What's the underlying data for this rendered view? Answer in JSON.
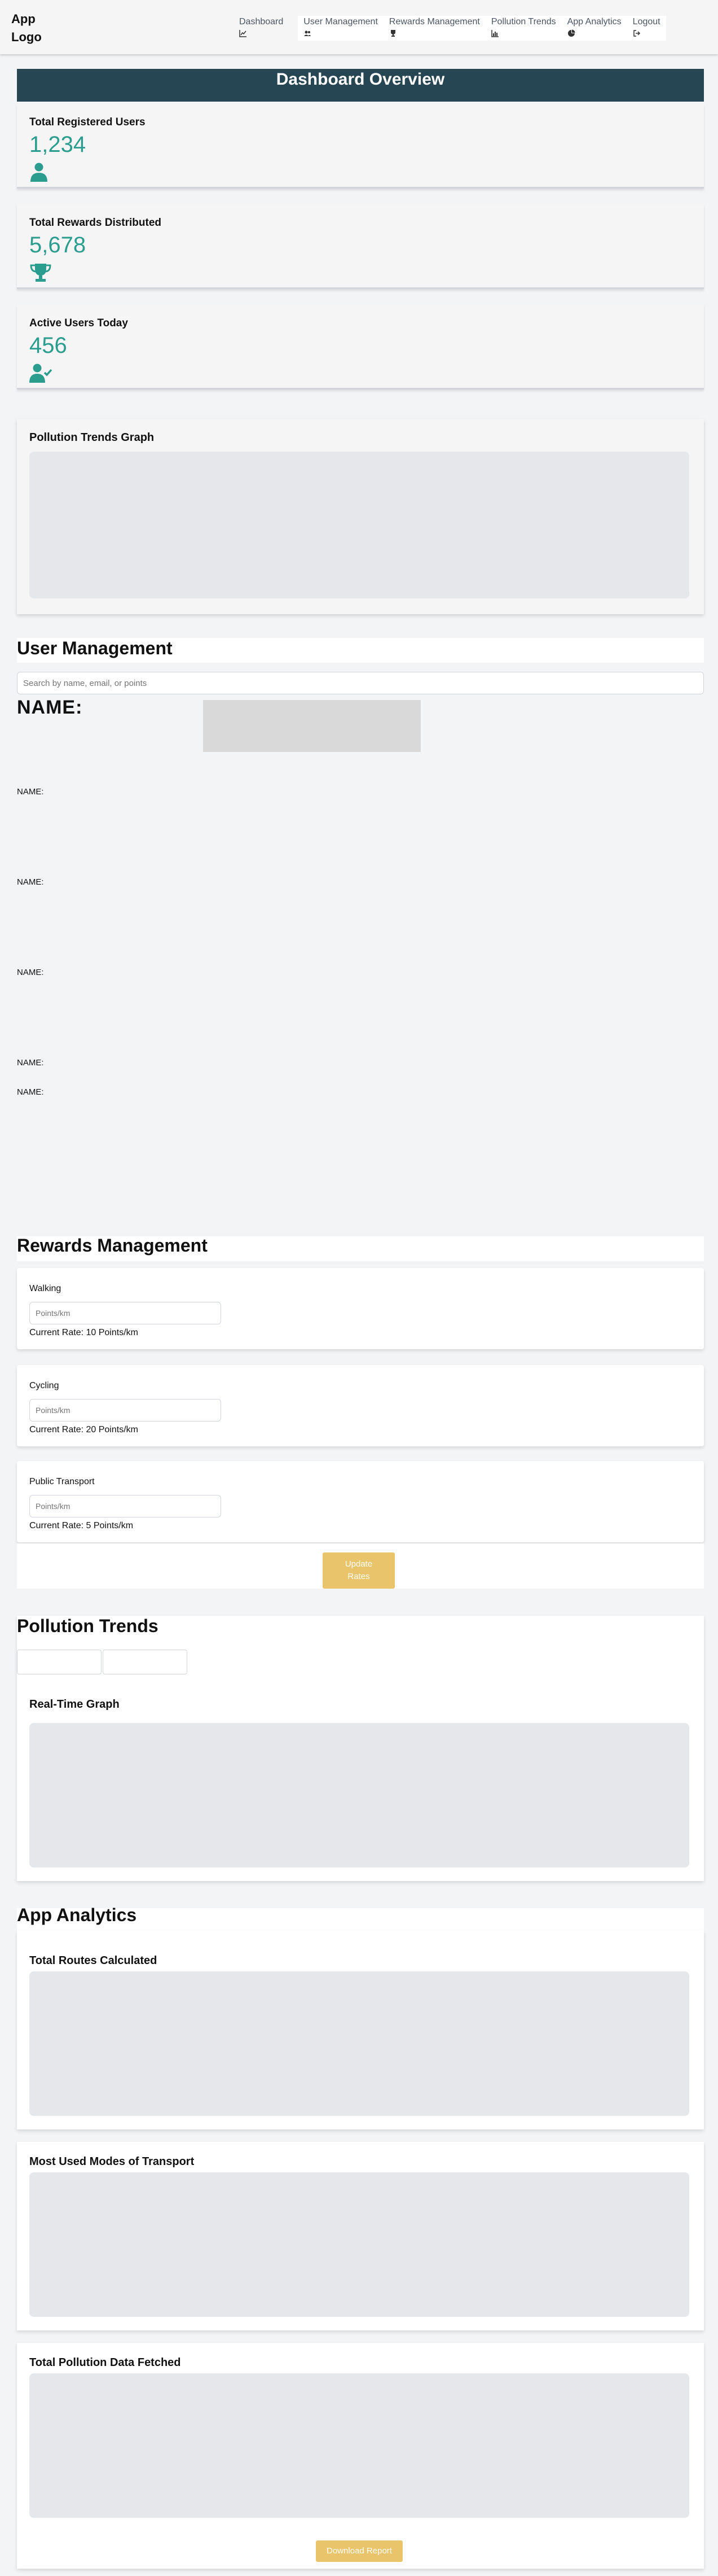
{
  "header": {
    "logo": "App Logo",
    "nav": [
      {
        "label": "Dashboard",
        "icon": "chart-line-icon"
      },
      {
        "label": "User Management",
        "icon": "users-icon"
      },
      {
        "label": "Rewards Management",
        "icon": "trophy-icon"
      },
      {
        "label": "Pollution Trends",
        "icon": "chart-bar-icon"
      },
      {
        "label": "App Analytics",
        "icon": "chart-pie-icon"
      },
      {
        "label": "Logout",
        "icon": "sign-out-icon"
      }
    ]
  },
  "dashboard": {
    "title": "Dashboard Overview",
    "stats": [
      {
        "label": "Total Registered Users",
        "value": "1,234",
        "icon": "user-icon"
      },
      {
        "label": "Total Rewards Distributed",
        "value": "5,678",
        "icon": "trophy-icon"
      },
      {
        "label": "Active Users Today",
        "value": "456",
        "icon": "user-check-icon"
      }
    ],
    "graph_title": "Pollution Trends Graph",
    "accent": "#2a9d8f",
    "title_bg": "#264653"
  },
  "users": {
    "title": "User Management",
    "search_placeholder": "Search by name, email, or points",
    "name_big": "NAME:",
    "name_rows": [
      "NAME:",
      "NAME:",
      "NAME:",
      "NAME:",
      "NAME:"
    ]
  },
  "rewards": {
    "title": "Rewards Management",
    "items": [
      {
        "mode": "Walking",
        "placeholder": "Points/km",
        "rate": "Current Rate: 10 Points/km"
      },
      {
        "mode": "Cycling",
        "placeholder": "Points/km",
        "rate": "Current Rate: 20 Points/km"
      },
      {
        "mode": "Public Transport",
        "placeholder": "Points/km",
        "rate": "Current Rate: 5 Points/km"
      }
    ],
    "update_label_1": "Update",
    "update_label_2": "Rates",
    "button_color": "#e9c46a"
  },
  "pollution": {
    "title": "Pollution Trends",
    "graph_title": "Real-Time Graph"
  },
  "analytics": {
    "title": "App Analytics",
    "cards": [
      "Total Routes Calculated",
      "Most Used Modes of Transport",
      "Total Pollution Data Fetched"
    ],
    "download_label": "Download Report"
  }
}
